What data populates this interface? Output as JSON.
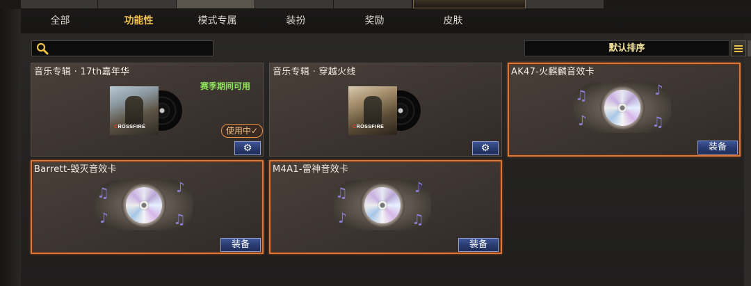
{
  "tabs": [
    {
      "label": "全部",
      "active": false
    },
    {
      "label": "功能性",
      "active": true
    },
    {
      "label": "模式专属",
      "active": false
    },
    {
      "label": "装扮",
      "active": false
    },
    {
      "label": "奖励",
      "active": false
    },
    {
      "label": "皮肤",
      "active": false
    }
  ],
  "search": {
    "placeholder": ""
  },
  "sort": {
    "label": "默认排序"
  },
  "items": [
    {
      "title": "音乐专辑 · 17th嘉年华",
      "season": "赛季期间可用",
      "status": "使用中✓",
      "cover_logo": "CROSSFIRE"
    },
    {
      "title": "音乐专辑 · 穿越火线",
      "cover_logo": "CROSSFIRE"
    },
    {
      "title": "AK47-火麒麟音效卡",
      "button": "装备"
    },
    {
      "title": "Barrett-毁灭音效卡",
      "button": "装备"
    },
    {
      "title": "M4A1-雷神音效卡",
      "button": "装备"
    }
  ],
  "colors": {
    "accent_tab": "#f2c14e",
    "highlight_border": "#d8783a",
    "button_blue": "#2a3c72",
    "season_green": "#8de45a"
  }
}
